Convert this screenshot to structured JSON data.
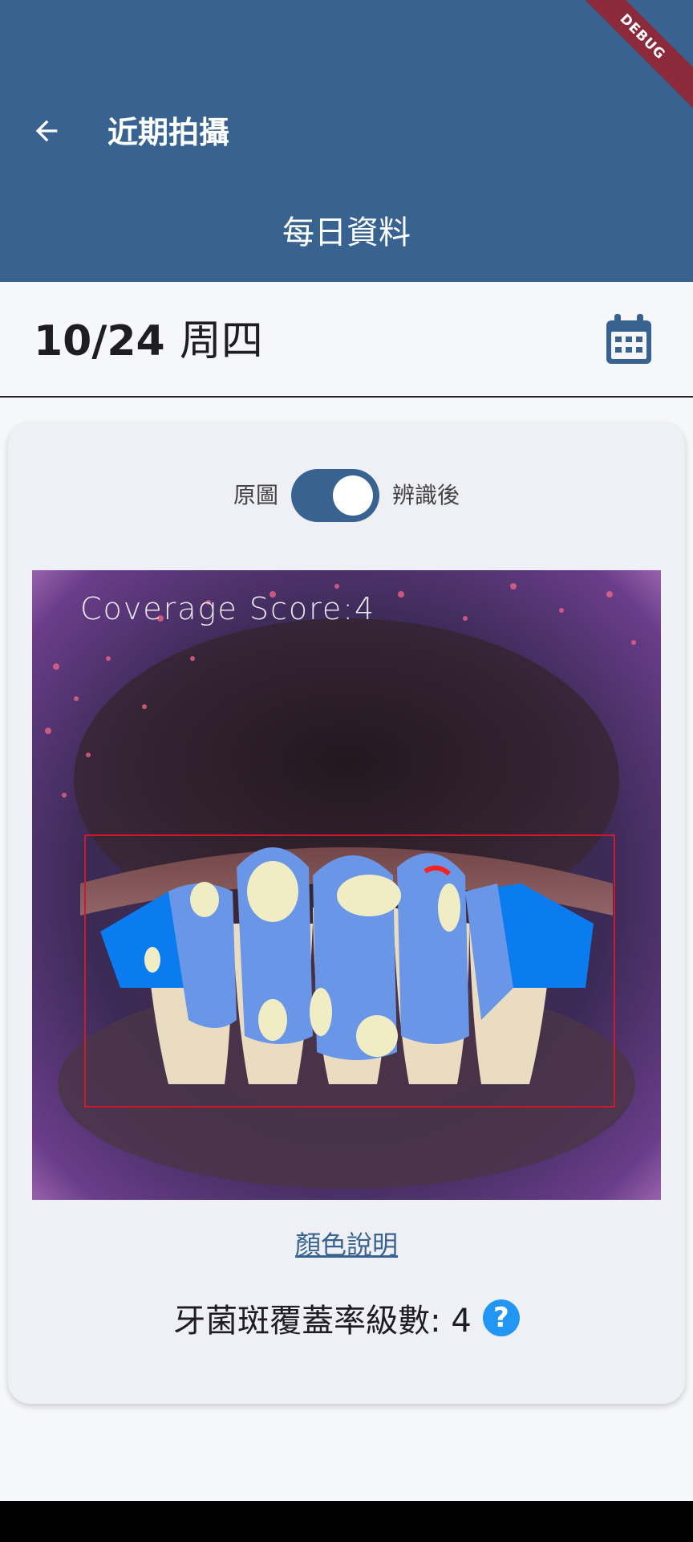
{
  "app_bar": {
    "title": "近期拍攝",
    "subtitle": "每日資料",
    "debug_banner": "DEBUG",
    "color": "#386391"
  },
  "date_row": {
    "date": "10/24",
    "weekday": "周四",
    "calendar_icon": "calendar-icon"
  },
  "toggle": {
    "left_label": "原圖",
    "right_label": "辨識後",
    "checked": true
  },
  "photo": {
    "overlay_text": "Coverage Score:4"
  },
  "legend_link": "顏色說明",
  "score": {
    "label": "牙菌斑覆蓋率級數: 4",
    "help_icon": "?"
  }
}
